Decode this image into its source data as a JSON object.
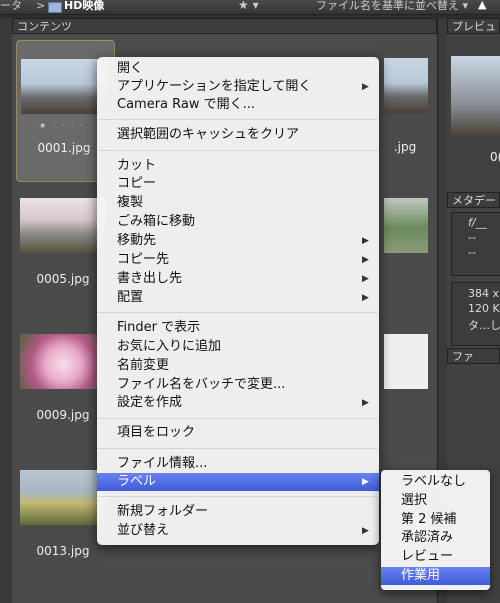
{
  "topbar": {
    "crumb": "ータ",
    "sep": ">",
    "folder_name": "HD映像",
    "star": "★ ▾",
    "sort_label": "ファイル名を基準に並べ替え ▾",
    "up_icon": "▲"
  },
  "panels": {
    "content_tab": "コンテンツ",
    "preview_tab": "プレビュ",
    "metadata_tab": "メタデー",
    "file_info_tab": "ファ"
  },
  "thumbnails": [
    {
      "name": "0001.jpg"
    },
    {
      "name": ".jpg"
    },
    {
      "name": "0005.jpg"
    },
    {
      "name": "0009.jpg"
    },
    {
      "name": "0013.jpg"
    }
  ],
  "rightpanel": {
    "preview_label": "0(",
    "meta_line1": "f/__",
    "meta_line2": "--",
    "meta_line3": "--",
    "size1": "384 x",
    "size2": "120 K",
    "type": "タ…し"
  },
  "menu": {
    "items": [
      {
        "label": "開く",
        "submenu": false
      },
      {
        "label": "アプリケーションを指定して開く",
        "submenu": true
      },
      {
        "label": "Camera Raw で開く...",
        "submenu": false
      },
      {
        "label": "選択範囲のキャッシュをクリア",
        "submenu": false
      },
      {
        "label": "カット",
        "submenu": false
      },
      {
        "label": "コピー",
        "submenu": false
      },
      {
        "label": "複製",
        "submenu": false
      },
      {
        "label": "ごみ箱に移動",
        "submenu": false
      },
      {
        "label": "移動先",
        "submenu": true
      },
      {
        "label": "コピー先",
        "submenu": true
      },
      {
        "label": "書き出し先",
        "submenu": true
      },
      {
        "label": "配置",
        "submenu": true
      },
      {
        "label": "Finder で表示",
        "submenu": false
      },
      {
        "label": "お気に入りに追加",
        "submenu": false
      },
      {
        "label": "名前変更",
        "submenu": false
      },
      {
        "label": "ファイル名をバッチで変更...",
        "submenu": false
      },
      {
        "label": "設定を作成",
        "submenu": true
      },
      {
        "label": "項目をロック",
        "submenu": false
      },
      {
        "label": "ファイル情報...",
        "submenu": false
      },
      {
        "label": "ラベル",
        "submenu": true,
        "highlighted": true
      },
      {
        "label": "新規フォルダー",
        "submenu": false
      },
      {
        "label": "並び替え",
        "submenu": true
      }
    ],
    "submenu_arrow": "▶"
  },
  "label_submenu": {
    "items": [
      {
        "label": "ラベルなし"
      },
      {
        "label": "選択"
      },
      {
        "label": "第 2 候補"
      },
      {
        "label": "承認済み"
      },
      {
        "label": "レビュー"
      },
      {
        "label": "作業用",
        "highlighted": true
      }
    ]
  },
  "colors": {
    "highlight": "#4a66e0",
    "background": "#2e2e2e",
    "panel": "#4b4b4b"
  }
}
